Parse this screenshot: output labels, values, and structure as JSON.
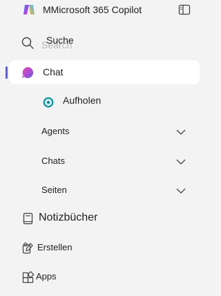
{
  "header": {
    "title": "MMicrosoft 365 Copilot",
    "logo_icon": "copilot-logo-icon",
    "toggle_icon": "sidebar-toggle-icon"
  },
  "nav": {
    "search": {
      "label": "Suche",
      "placeholder": "Search",
      "icon": "search-icon"
    },
    "chat": {
      "label": "Chat",
      "icon": "copilot-chat-icon",
      "active": true
    },
    "catchup": {
      "label": "Aufholen",
      "icon": "catchup-icon"
    },
    "agents": {
      "label": "Agents",
      "icon": "chevron-down-icon"
    },
    "chats": {
      "label": "Chats",
      "icon": "chevron-down-icon"
    },
    "pages": {
      "label": "Seiten",
      "icon": "chevron-down-icon"
    },
    "notebooks": {
      "label": "Notizbücher",
      "icon": "notebook-icon"
    },
    "create": {
      "label": "Erstellen",
      "icon": "create-icon"
    },
    "apps": {
      "label": "Apps",
      "icon": "apps-icon"
    }
  },
  "colors": {
    "background": "#f3f3f3",
    "active_background": "#ffffff",
    "accent": "#5b5fc7"
  }
}
